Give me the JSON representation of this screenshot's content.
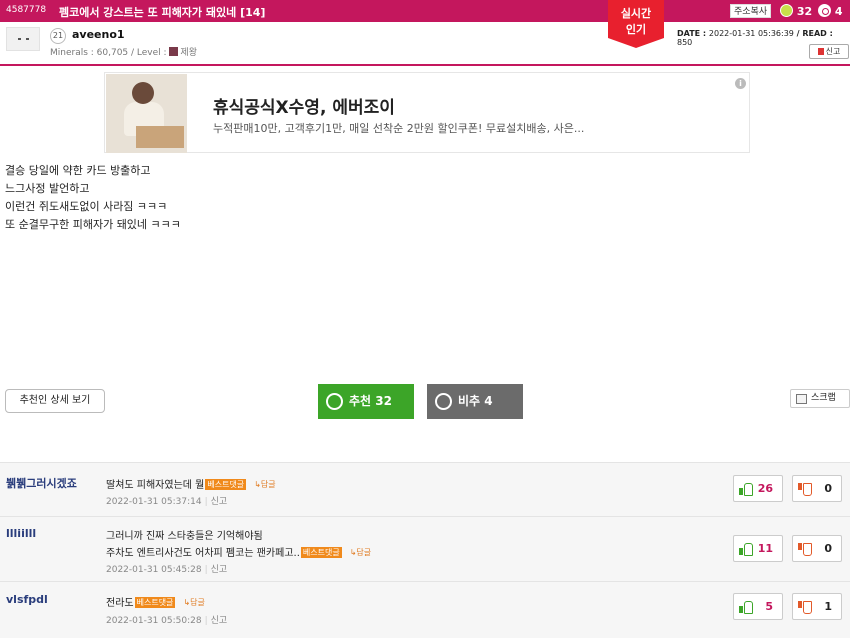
{
  "header": {
    "post_id": "4587778",
    "title": "펨코에서 강스트는 또 피해자가 돼있네 [14]",
    "address_copy": "주소복사",
    "up_count": "32",
    "down_count": "4",
    "badge_line1": "실시간",
    "badge_line2": "인기"
  },
  "author": {
    "level": "21",
    "name": "aveeno1",
    "minerals": "Minerals : 60,705 / Level : ",
    "rank": "제왕",
    "date_label": "DATE : ",
    "date": "2022-01-31 05:36:39",
    "read_label": " / READ : ",
    "read": "850",
    "report": "신고"
  },
  "ad": {
    "headline": "휴식공식X수영, 에버조이",
    "sub": "누적판매10만, 고객후기1만, 매일 선착순 2만원 할인쿠폰! 무료설치배송, 사은...",
    "info": "i"
  },
  "post": {
    "lines": [
      "결승 당일에 약한 카드 방출하고",
      "느그사정 발언하고",
      "이런건 쥐도새도없이 사라짐 ㅋㅋㅋ",
      "또 순결무구한 피해자가 돼있네 ㅋㅋㅋ"
    ]
  },
  "actions": {
    "detail": "추천인 상세 보기",
    "recommend": "추천 32",
    "not_recommend": "비추 4",
    "scrap": "스크랩"
  },
  "comments": [
    {
      "nick": "뷁뷁그러시겠죠",
      "lines": [
        "딸쳐도 피해자였는데 뭘"
      ],
      "best": "베스트댓글",
      "reply": "↳답글",
      "date": "2022-01-31 05:37:14",
      "report": "신고",
      "up": "26",
      "down": "0"
    },
    {
      "nick": "llliilll",
      "lines": [
        "그러니까 진짜 스타충들은 기억해야됨",
        "주차도 엔트리사건도 어차피 펨코는 팬카페고.."
      ],
      "best": "베스트댓글",
      "reply": "↳답글",
      "date": "2022-01-31 05:45:28",
      "report": "신고",
      "up": "11",
      "down": "0"
    },
    {
      "nick": "vlsfpdl",
      "lines": [
        "전라도"
      ],
      "best": "베스트댓글",
      "reply": "↳답글",
      "date": "2022-01-31 05:50:28",
      "report": "신고",
      "up": "5",
      "down": "1"
    }
  ],
  "colors": {
    "brand": "#c4175d",
    "recommend": "#3ca528",
    "not_recommend": "#6b6b6b",
    "badge": "#e8202e",
    "best_tag": "#f08a1c"
  }
}
